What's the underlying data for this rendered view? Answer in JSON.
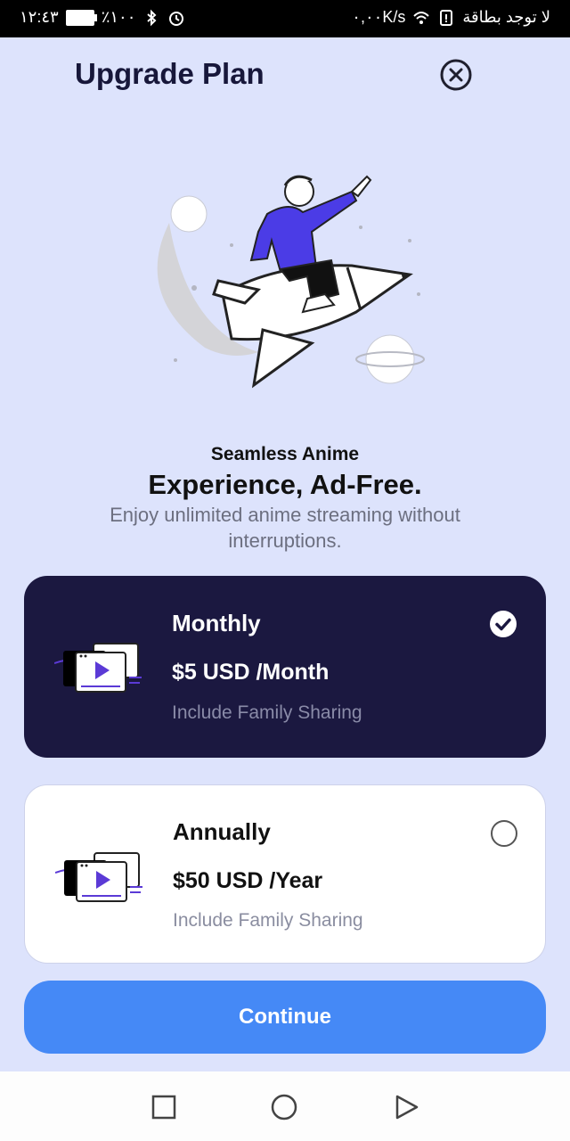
{
  "status_bar": {
    "time": "١٢:٤٣",
    "battery": "٪١٠٠",
    "speed": "٠,٠٠K/s",
    "carrier": "لا توجد بطاقة"
  },
  "header": {
    "title": "Upgrade Plan"
  },
  "hero": {
    "headline_small": "Seamless Anime",
    "headline_big": "Experience, Ad-Free.",
    "subtitle": "Enjoy unlimited anime streaming without interruptions."
  },
  "plans": [
    {
      "name": "Monthly",
      "price": "$5 USD /Month",
      "note": "Include Family Sharing",
      "selected": true
    },
    {
      "name": "Annually",
      "price": "$50 USD /Year",
      "note": "Include Family Sharing",
      "selected": false
    }
  ],
  "continue_label": "Continue",
  "colors": {
    "background": "#dde3fc",
    "selected_card": "#1b1840",
    "accent_button": "#4589f6",
    "play_icon": "#5b3ad6"
  },
  "icons": {
    "close": "close-circle-icon",
    "selected": "check-circle-icon",
    "unselected": "radio-empty-icon",
    "plan": "video-player-icon",
    "nav": [
      "square-recent-icon",
      "circle-home-icon",
      "triangle-back-icon"
    ]
  }
}
